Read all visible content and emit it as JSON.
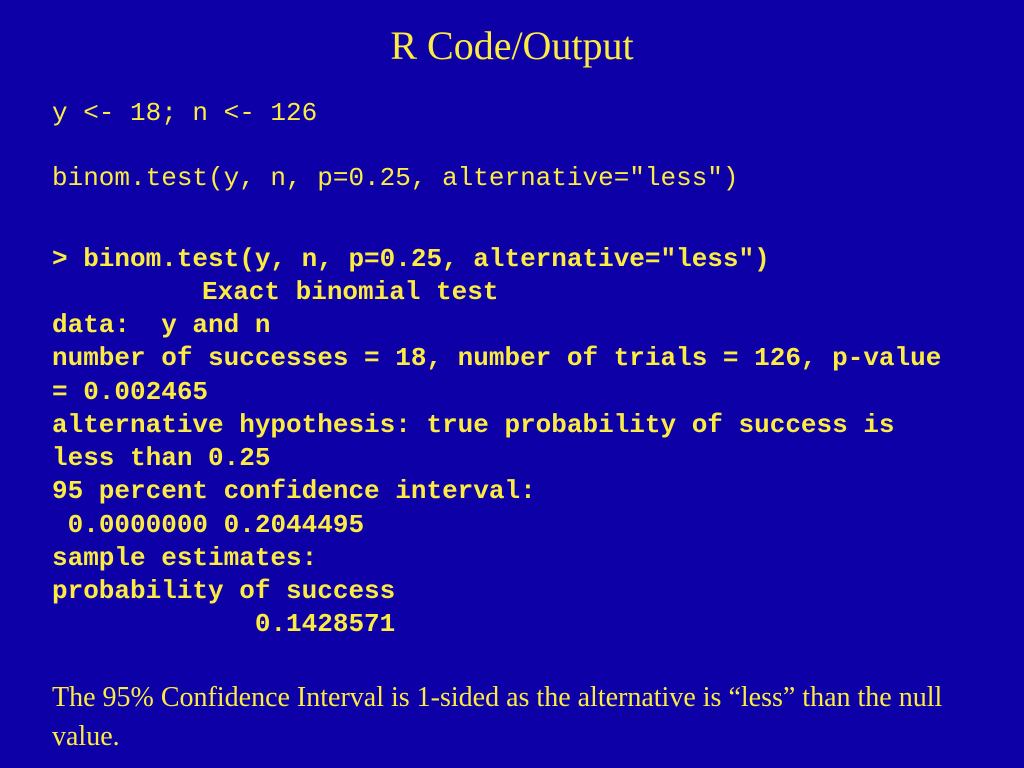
{
  "title": "R Code/Output",
  "code": {
    "line1": "y <- 18; n <- 126",
    "line2": "binom.test(y, n, p=0.25, alternative=\"less\")"
  },
  "output": {
    "line1": "> binom.test(y, n, p=0.25, alternative=\"less\")",
    "line2": "Exact binomial test",
    "line3": "data:  y and n",
    "line4": "number of successes = 18, number of trials = 126, p-value = 0.002465",
    "line5": "alternative hypothesis: true probability of success is less than 0.25",
    "line6": "95 percent confidence interval:",
    "line7": " 0.0000000 0.2044495",
    "line8": "sample estimates:",
    "line9": "probability of success",
    "line10": "             0.1428571"
  },
  "conclusion": "The 95% Confidence Interval is 1-sided as the alternative is “less” than the null value."
}
